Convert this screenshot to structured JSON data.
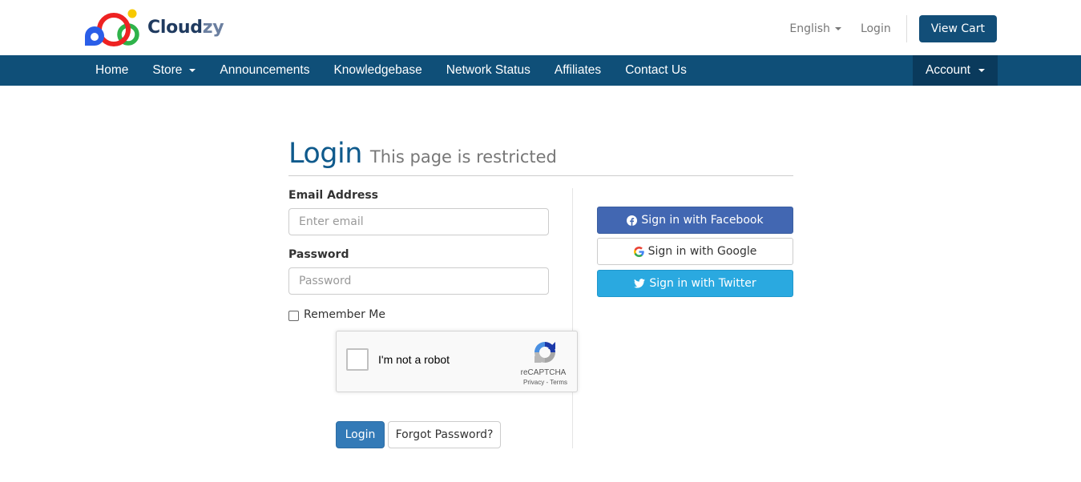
{
  "header": {
    "brand": {
      "name_main": "Cloud",
      "name_accent": "zy"
    },
    "language_label": "English",
    "login_link": "Login",
    "view_cart_button": "View Cart"
  },
  "nav": {
    "items": [
      {
        "label": "Home",
        "has_dropdown": false
      },
      {
        "label": "Store",
        "has_dropdown": true
      },
      {
        "label": "Announcements",
        "has_dropdown": false
      },
      {
        "label": "Knowledgebase",
        "has_dropdown": false
      },
      {
        "label": "Network Status",
        "has_dropdown": false
      },
      {
        "label": "Affiliates",
        "has_dropdown": false
      },
      {
        "label": "Contact Us",
        "has_dropdown": false
      }
    ],
    "account_label": "Account"
  },
  "page": {
    "title": "Login",
    "subtitle": "This page is restricted"
  },
  "form": {
    "email": {
      "label": "Email Address",
      "placeholder": "Enter email",
      "value": ""
    },
    "password": {
      "label": "Password",
      "placeholder": "Password",
      "value": ""
    },
    "remember_me": {
      "label": "Remember Me",
      "checked": false
    },
    "recaptcha": {
      "label": "I'm not a robot",
      "brand": "reCAPTCHA",
      "privacy": "Privacy",
      "separator": " - ",
      "terms": "Terms",
      "checked": false
    },
    "login_button": "Login",
    "forgot_button": "Forgot Password?"
  },
  "social": {
    "facebook": {
      "label": "Sign in with Facebook",
      "color": "#4267b2"
    },
    "google": {
      "label": "Sign in with Google",
      "color": "#ffffff"
    },
    "twitter": {
      "label": "Sign in with Twitter",
      "color": "#2aa9e0"
    }
  },
  "colors": {
    "primary": "#0f4f78",
    "account_bg": "#0a3a5c",
    "title": "#0f5a8c",
    "login_button": "#337ab7"
  }
}
